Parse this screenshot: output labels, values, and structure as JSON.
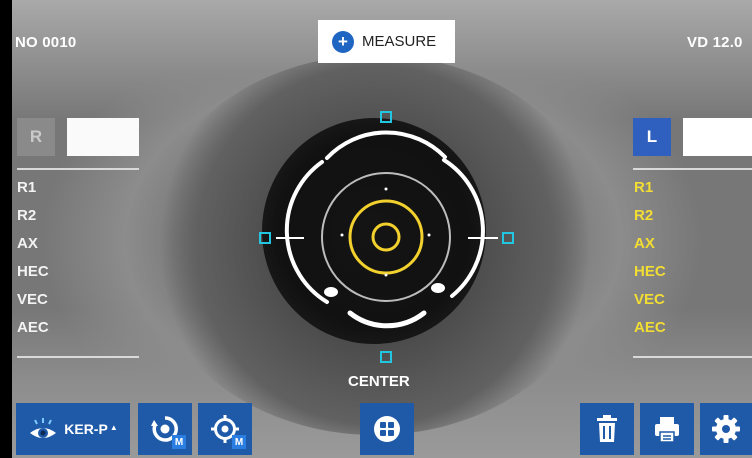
{
  "header": {
    "patient_no": "NO 0010",
    "vd": "VD 12.0",
    "measure_label": "MEASURE",
    "measure_icon": "plus-icon"
  },
  "right_eye": {
    "badge": "R",
    "active": false
  },
  "left_eye": {
    "badge": "L",
    "active": true
  },
  "params_labels": [
    "R1",
    "R2",
    "AX",
    "HEC",
    "VEC",
    "AEC"
  ],
  "alignment": {
    "label": "CENTER"
  },
  "toolbar": {
    "mode_label": "KER-P",
    "mode_arrow": "▲",
    "m_badge": "M",
    "icons": [
      "eye-icon",
      "tracking-m-icon",
      "target-m-icon",
      "grid-icon",
      "trash-icon",
      "print-icon",
      "gear-icon"
    ]
  },
  "colors": {
    "accent_blue": "#1e5aa8",
    "marker_cyan": "#23c6e0",
    "target_yellow": "#f2d02e",
    "left_eye_badge": "#2f5fbf",
    "right_eye_badge": "#8a8a8a"
  }
}
